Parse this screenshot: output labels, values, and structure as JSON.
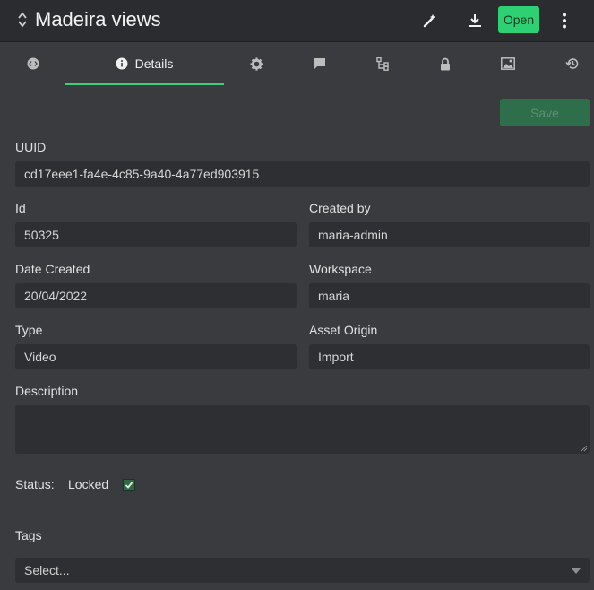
{
  "header": {
    "title": "Madeira views",
    "open_label": "Open",
    "icons": [
      "sort-icon",
      "wand-icon",
      "download-icon",
      "kebab-menu-icon"
    ]
  },
  "tabs": [
    {
      "icon": "code-icon",
      "label": ""
    },
    {
      "icon": "info-icon",
      "label": "Details"
    },
    {
      "icon": "gear-icon",
      "label": ""
    },
    {
      "icon": "comment-icon",
      "label": ""
    },
    {
      "icon": "hierarchy-icon",
      "label": ""
    },
    {
      "icon": "lock-icon",
      "label": ""
    },
    {
      "icon": "image-icon",
      "label": ""
    },
    {
      "icon": "history-icon",
      "label": ""
    }
  ],
  "form": {
    "save_label": "Save",
    "uuid_label": "UUID",
    "uuid_value": "cd17eee1-fa4e-4c85-9a40-4a77ed903915",
    "id_label": "Id",
    "id_value": "50325",
    "created_by_label": "Created by",
    "created_by_value": "maria-admin",
    "date_created_label": "Date Created",
    "date_created_value": "20/04/2022",
    "workspace_label": "Workspace",
    "workspace_value": "maria",
    "type_label": "Type",
    "type_value": "Video",
    "asset_origin_label": "Asset Origin",
    "asset_origin_value": "Import",
    "description_label": "Description",
    "description_value": "",
    "status_label": "Status:",
    "locked_label": "Locked",
    "locked_checked": true,
    "tags_label": "Tags",
    "tags_placeholder": "Select..."
  },
  "colors": {
    "accent": "#2fcf73",
    "background": "#3a3b3f",
    "header_bg": "#2b2c30",
    "field_bg": "#2e2f33"
  }
}
